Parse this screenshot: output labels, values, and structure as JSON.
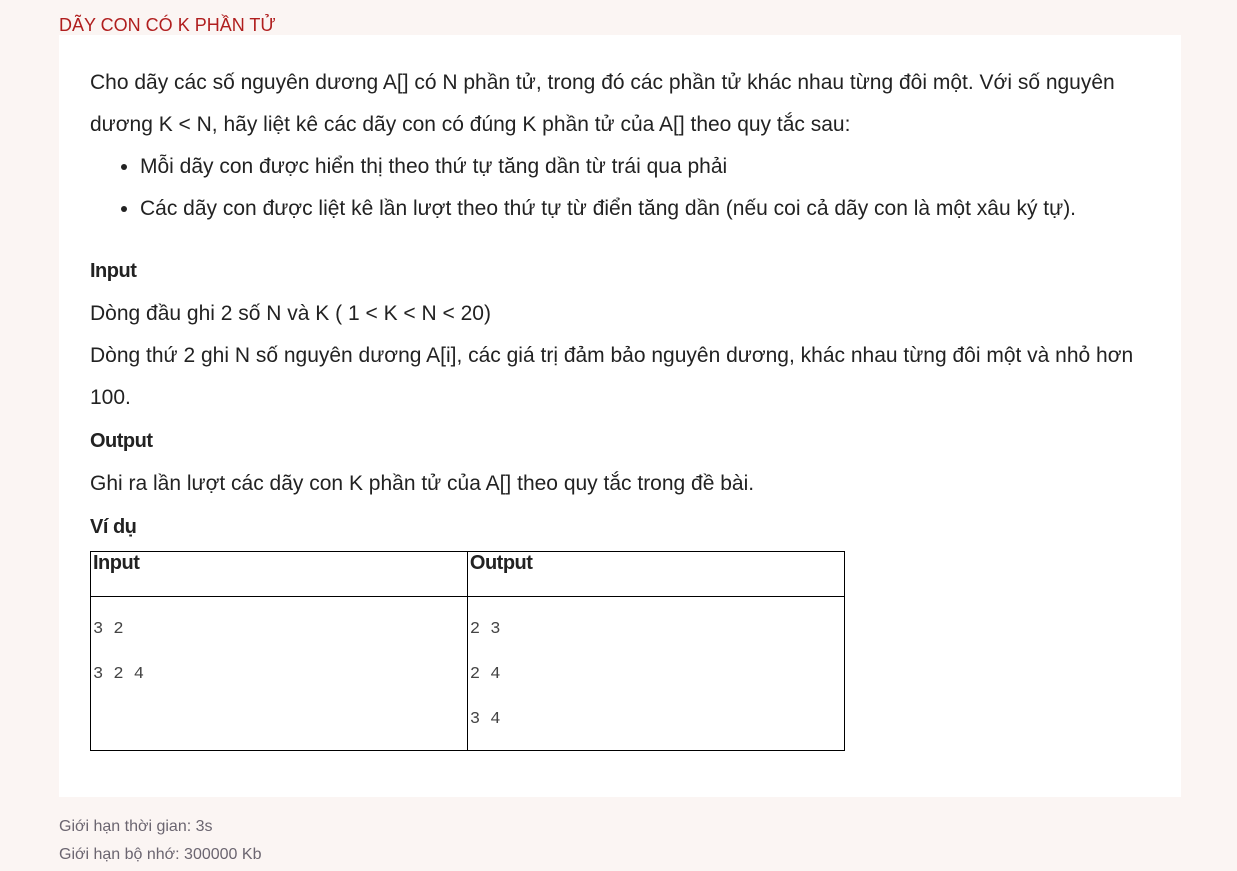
{
  "title": "DÃY CON CÓ K PHẦN TỬ",
  "description": {
    "intro": "Cho dãy các số nguyên dương A[] có N phần tử, trong đó các phần tử khác nhau từng đôi một. Với số nguyên dương K < N, hãy liệt kê các dãy con có đúng K phần tử của A[] theo quy tắc sau:",
    "rules": [
      "Mỗi dãy con được hiển thị theo thứ tự tăng dần từ trái qua phải",
      "Các dãy con được liệt kê lần lượt theo thứ tự từ điển tăng dần (nếu coi cả dãy con là một xâu ký tự)."
    ]
  },
  "input_section": {
    "heading": "Input",
    "line1": "Dòng đầu ghi 2 số N và K ( 1 < K < N < 20)",
    "line2": "Dòng thứ 2 ghi N số nguyên dương A[i], các giá trị đảm bảo nguyên dương, khác nhau từng đôi một và nhỏ hơn 100."
  },
  "output_section": {
    "heading": "Output",
    "line1": "Ghi ra lần lượt các dãy con K phần tử của A[] theo quy tắc trong đề bài."
  },
  "example": {
    "heading": "Ví dụ",
    "columns": [
      "Input",
      "Output"
    ],
    "input_lines": [
      "3 2",
      "3 2 4"
    ],
    "output_lines": [
      "2 3",
      "2 4",
      "3 4"
    ]
  },
  "limits": {
    "time": "Giới hạn thời gian: 3s",
    "memory": "Giới hạn bộ nhớ: 300000 Kb"
  }
}
